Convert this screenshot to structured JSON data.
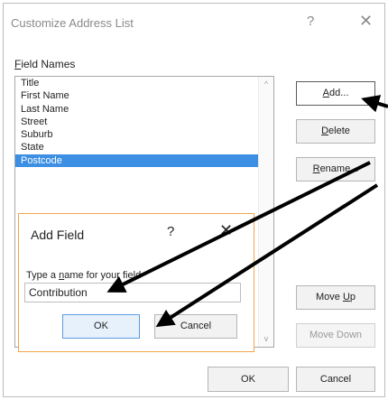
{
  "window": {
    "title": "Customize Address List",
    "help_glyph": "?",
    "close_glyph": "✕"
  },
  "field_names": {
    "label_underlined": "F",
    "label_rest": "ield Names",
    "items": [
      "Title",
      "First Name",
      "Last Name",
      "Street",
      "Suburb",
      "State",
      "Postcode"
    ],
    "selected": "Postcode"
  },
  "buttons": {
    "add": {
      "u": "A",
      "rest": "dd..."
    },
    "delete": {
      "u": "D",
      "rest": "elete"
    },
    "rename": {
      "u": "R",
      "rest": "ename..."
    },
    "move_up": {
      "pre": "Move ",
      "u": "U",
      "rest": "p"
    },
    "move_down": "Move Down",
    "ok": "OK",
    "cancel": "Cancel"
  },
  "add_field_dialog": {
    "title": "Add Field",
    "help_glyph": "?",
    "close_glyph": "✕",
    "prompt_pre": "Type a ",
    "prompt_u": "n",
    "prompt_rest": "ame for your field",
    "input_value": "Contribution",
    "ok": "OK",
    "cancel": "Cancel"
  },
  "colors": {
    "selection": "#3c8fe2",
    "dialog_border": "#f2a54a",
    "annotation_arrow": "#000000"
  }
}
